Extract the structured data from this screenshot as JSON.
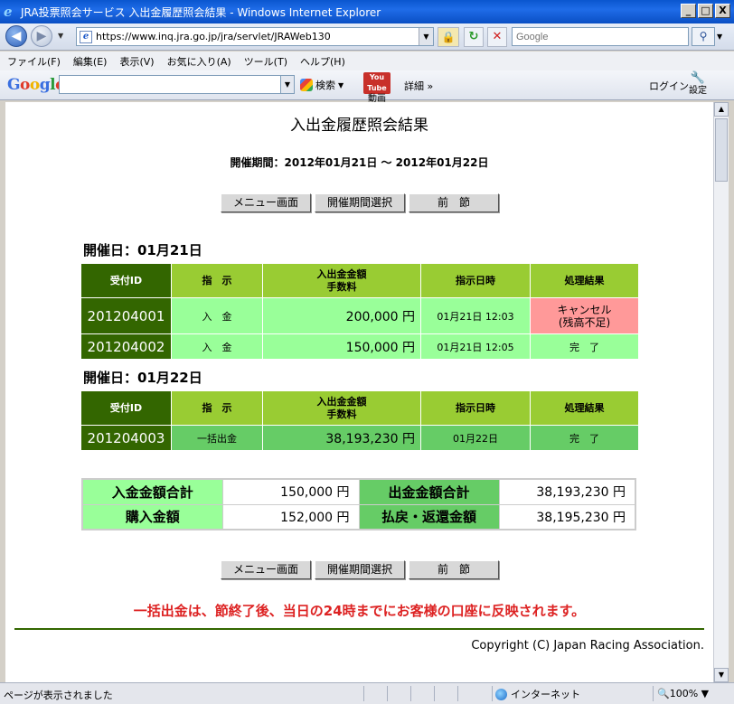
{
  "window": {
    "title": "JRA投票照会サービス 入出金履歴照会結果 - Windows Internet Explorer",
    "buttons": [
      "_",
      "□",
      "X"
    ]
  },
  "addressbar": {
    "url": "https://www.inq.jra.go.jp/jra/servlet/JRAWeb130",
    "search_placeholder": "Google"
  },
  "menu": [
    "ファイル(F)",
    "編集(E)",
    "表示(V)",
    "お気に入り(A)",
    "ツール(T)",
    "ヘルプ(H)"
  ],
  "google_toolbar": {
    "logo": "Google",
    "search_label": "検索",
    "video_label": "動画",
    "video_badge": "You Tube",
    "detail_label": "詳細 »",
    "login_label": "ログイン",
    "settings_label": "設定"
  },
  "page": {
    "title": "入出金履歴照会結果",
    "period": "開催期間：2012年01月21日 〜 2012年01月22日",
    "buttons": {
      "menu": "メニュー画面",
      "period_select": "開催期間選択",
      "prev_meet": "前　節"
    },
    "headers": {
      "id": "受付ID",
      "instruction": "指　示",
      "amount": "入出金金額",
      "fee": "手数料",
      "datetime": "指示日時",
      "result": "処理結果"
    },
    "days": [
      {
        "label": "開催日：01月21日",
        "rows": [
          {
            "id": "201204001",
            "instruction": "入　金",
            "amount": "200,000 円",
            "datetime": "01月21日 12:03",
            "result_line1": "キャンセル",
            "result_line2": "(残高不足)"
          },
          {
            "id": "201204002",
            "instruction": "入　金",
            "amount": "150,000 円",
            "datetime": "01月21日 12:05",
            "result": "完　了"
          }
        ]
      },
      {
        "label": "開催日：01月22日",
        "rows": [
          {
            "id": "201204003",
            "instruction": "一括出金",
            "amount": "38,193,230 円",
            "datetime": "01月22日",
            "result": "完　了"
          }
        ]
      }
    ],
    "summary": {
      "deposit_total_label": "入金金額合計",
      "deposit_total": "150,000 円",
      "withdraw_total_label": "出金金額合計",
      "withdraw_total": "38,193,230 円",
      "purchase_label": "購入金額",
      "purchase": "152,000 円",
      "payout_label": "払戻・返還金額",
      "payout": "38,195,230 円"
    },
    "notice": "一括出金は、節終了後、当日の24時までにお客様の口座に反映されます。",
    "copyright": "Copyright (C) Japan Racing Association."
  },
  "statusbar": {
    "message": "ページが表示されました",
    "zone": "インターネット",
    "zoom": "100%"
  },
  "colors": {
    "header_dark": "#336600",
    "header_light": "#99cc33",
    "row_light": "#99ff99",
    "row_dark": "#66cc66",
    "cancel": "#ff9999",
    "notice": "#dd2222"
  }
}
